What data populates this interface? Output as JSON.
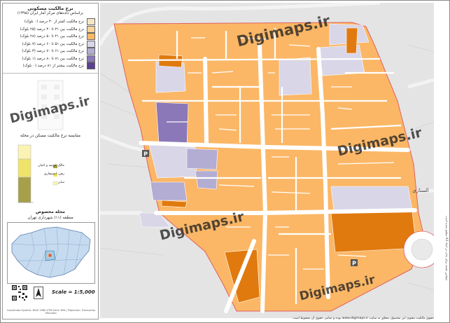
{
  "legend": {
    "title": "نرخ مالکیت مسکونی",
    "subtitle": "براساس داده‌های مرکز آمار ایران (۱۳۹۵)",
    "classes": [
      {
        "label": "نرخ مالکیت کمتر از ۳۰ درصد (۰ بلوک)",
        "color": "#f6e6c8"
      },
      {
        "label": "نرخ مالکیت بین ۳۱ تا ۴۰ درصد (۲۵ بلوک)",
        "color": "#fcd39b"
      },
      {
        "label": "نرخ مالکیت بین ۴۱ تا ۵۰ درصد (۲۸ بلوک)",
        "color": "#fbb766"
      },
      {
        "label": "نرخ مالکیت بین ۵۱ تا ۶۰ درصد (۷ بلوک)",
        "color": "#d9d6e8"
      },
      {
        "label": "نرخ مالکیت بین ۶۱ تا ۷۰ درصد (۳ بلوک)",
        "color": "#b3acd3"
      },
      {
        "label": "نرخ مالکیت بین ۷۱ تا ۸۰ درصد (۱ بلوک)",
        "color": "#8a78b8"
      },
      {
        "label": "نرخ مالکیت بیشتر از ۸۱ درصد (۰ بلوک)",
        "color": "#5b3f91"
      }
    ],
    "chart_title": "مقایسه نرخ مالکیت مسکن در محله",
    "chart_legend": [
      {
        "label": "مالک عرصه و اعیان",
        "color": "#a6a04a"
      },
      {
        "label": "رهن، استیجاری",
        "color": "#efe36a"
      },
      {
        "label": "سایر",
        "color": "#fbf3b3"
      }
    ],
    "inset_title": "محله مخصوص",
    "inset_subtitle": "منطقه (۱۱) شهرداری تهران",
    "scale_text": "Scale = 1:5,000",
    "footer": "Coordinate System: WGS 1984 UTM Zone 39N | Projection: Transverse Mercator"
  },
  "map": {
    "labels": [
      {
        "text": "الستاری"
      }
    ],
    "parking_symbol": "P"
  },
  "side_note": "مقیاس نقشه برای چاپ در ابعاد A3 تنظیم شده است",
  "bottom_note": "حقوق مالکیت معنوی این محصول متعلق به سایت www.digimaps.ir بوده و تمامی حقوق آن محفوظ است.",
  "watermark": "Digimaps.ir",
  "colors": {
    "c1": "#f6e6c8",
    "c2": "#fcd39b",
    "c3": "#fbb766",
    "c4": "#d9d6e8",
    "c5": "#b3acd3",
    "c6": "#8a78b8",
    "c7": "#5b3f91",
    "dark": "#e07a0e"
  }
}
